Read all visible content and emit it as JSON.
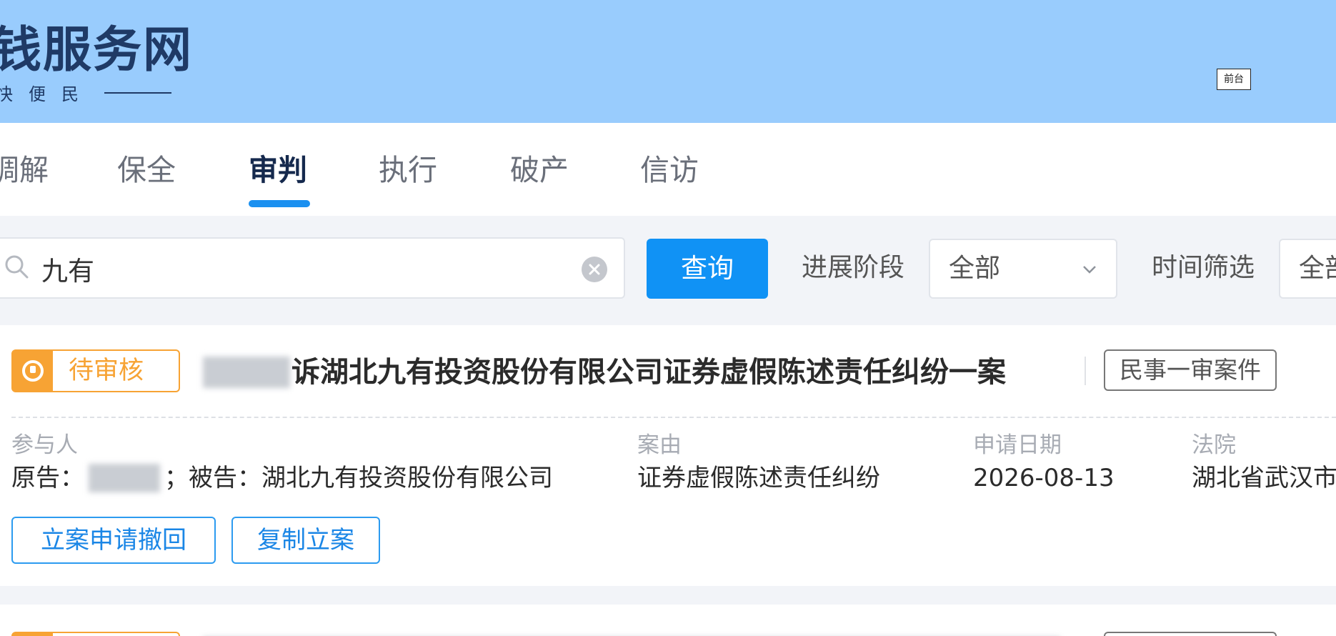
{
  "header": {
    "site_title": "钱服务网",
    "site_subtitle": "快便民",
    "frontdesk_button": "前台"
  },
  "tabs": [
    {
      "label": "调解",
      "active": false
    },
    {
      "label": "保全",
      "active": false
    },
    {
      "label": "审判",
      "active": true
    },
    {
      "label": "执行",
      "active": false
    },
    {
      "label": "破产",
      "active": false
    },
    {
      "label": "信访",
      "active": false
    }
  ],
  "search": {
    "value": "九有",
    "query_button": "查询",
    "stage_label": "进展阶段",
    "stage_value": "全部",
    "time_label": "时间筛选",
    "time_value": "全部"
  },
  "cases": [
    {
      "status": "待审核",
      "title": "诉湖北九有投资股份有限公司证券虚假陈述责任纠纷一案",
      "case_type": "民事一审案件",
      "participants_label": "参与人",
      "plaintiff_prefix": "原告：",
      "defendant_text": "；被告：湖北九有投资股份有限公司",
      "cause_label": "案由",
      "cause_value": "证券虚假陈述责任纠纷",
      "date_label": "申请日期",
      "date_value": "2026-08-13",
      "court_label": "法院",
      "court_value": "湖北省武汉市",
      "actions": [
        "立案申请撤回",
        "复制立案"
      ]
    }
  ],
  "colors": {
    "header_bg": "#99ccfd",
    "accent_blue": "#1092f5",
    "pending_orange": "#f7a334"
  }
}
